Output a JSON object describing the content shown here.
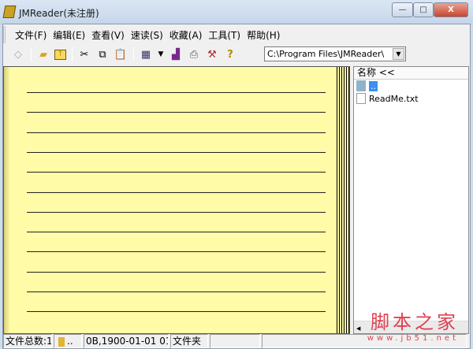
{
  "window": {
    "title": "JMReader(未注册)",
    "min": "—",
    "max": "□",
    "close": "X"
  },
  "menu": [
    "文件(F)",
    "编辑(E)",
    "查看(V)",
    "速读(S)",
    "收藏(A)",
    "工具(T)",
    "帮助(H)"
  ],
  "toolbar": {
    "path": "C:\\Program Files\\JMReader\\",
    "icons": [
      "eraser-icon",
      "open-folder-icon",
      "up-folder-icon",
      "cut-icon",
      "copy-icon",
      "paste-icon",
      "grid-icon",
      "dropdown-arrow-icon",
      "chart-icon",
      "print-icon",
      "tools-icon",
      "help-icon"
    ]
  },
  "filelist": {
    "header": "名称 <<",
    "items": [
      {
        "name": "..",
        "type": "folder"
      },
      {
        "name": "ReadMe.txt",
        "type": "file"
      }
    ]
  },
  "status": {
    "count": "文件总数:1",
    "folder_name": "..",
    "info": "0B,1900-01-01 01:(",
    "type": "文件夹",
    "empty1": "",
    "empty2": ""
  },
  "watermark": {
    "text": "脚本之家",
    "url": "www.jb51.net"
  },
  "colors": {
    "page": "#fffba6",
    "highlight": "#3c8ff0"
  }
}
